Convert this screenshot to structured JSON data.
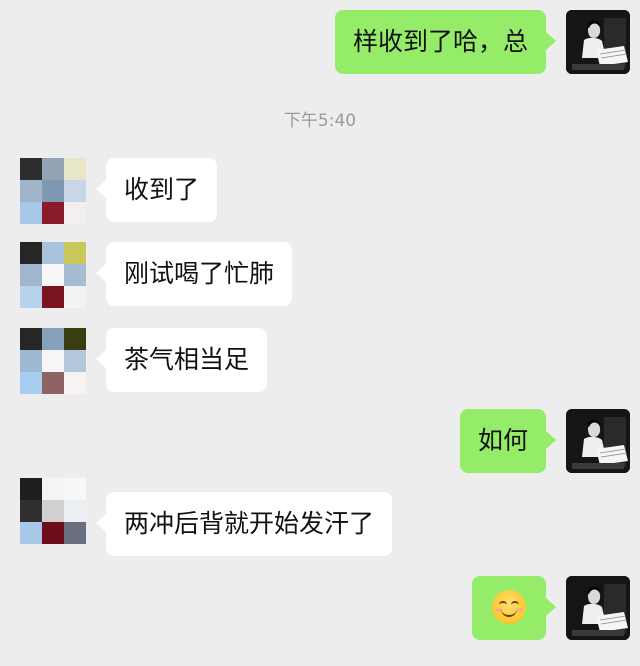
{
  "chat": {
    "timestamp": "下午5:40",
    "messages": [
      {
        "side": "right",
        "text": "样收到了哈，总"
      },
      {
        "side": "left",
        "text": "收到了"
      },
      {
        "side": "left",
        "text": "刚试喝了忙肺"
      },
      {
        "side": "left",
        "text": "茶气相当足"
      },
      {
        "side": "right",
        "text": "如何"
      },
      {
        "side": "left",
        "text": "两冲后背就开始发汗了"
      },
      {
        "side": "right",
        "text": "",
        "emoji": "smiling-face-emoji"
      }
    ]
  },
  "colors": {
    "background": "#ededed",
    "self_bubble": "#95ec69",
    "other_bubble": "#ffffff",
    "timestamp_text": "#9a9a9a"
  }
}
